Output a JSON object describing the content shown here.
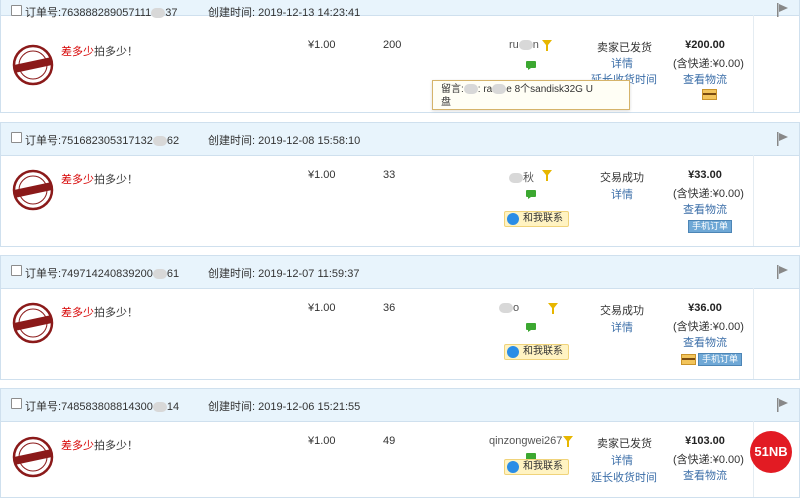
{
  "orders": [
    {
      "order_no_label": "订单号:",
      "order_no": "763888289057111",
      "order_no_tail": "37",
      "created_label": "创建时间:",
      "created": "2019-12-13 14:23:41",
      "title_highlight": "差多少",
      "title_rest": "拍多少！",
      "price": "¥1.00",
      "qty": "200",
      "buyer_left": "ru",
      "buyer_right": "n",
      "status": "卖家已发货",
      "detail": "详情",
      "extend": "延长收货时间",
      "total": "¥200.00",
      "shipping": "(含快递:¥0.00)",
      "logistics": "查看物流"
    },
    {
      "order_no_label": "订单号:",
      "order_no": "751682305317132",
      "order_no_tail": "62",
      "created_label": "创建时间:",
      "created": "2019-12-08 15:58:10",
      "title_highlight": "差多少",
      "title_rest": "拍多少！",
      "price": "¥1.00",
      "qty": "33",
      "buyer_left": "",
      "buyer_right": "秋",
      "contact": "和我联系",
      "status": "交易成功",
      "detail": "详情",
      "total": "¥33.00",
      "shipping": "(含快递:¥0.00)",
      "logistics": "查看物流",
      "mobile_order": "手机订单"
    },
    {
      "order_no_label": "订单号:",
      "order_no": "749714240839200",
      "order_no_tail": "61",
      "created_label": "创建时间:",
      "created": "2019-12-07 11:59:37",
      "title_highlight": "差多少",
      "title_rest": "拍多少！",
      "price": "¥1.00",
      "qty": "36",
      "buyer_left": "",
      "buyer_right": "o",
      "contact": "和我联系",
      "status": "交易成功",
      "detail": "详情",
      "total": "¥36.00",
      "shipping": "(含快递:¥0.00)",
      "logistics": "查看物流",
      "mobile_order": "手机订单"
    },
    {
      "order_no_label": "订单号:",
      "order_no": "748583808814300",
      "order_no_tail": "14",
      "created_label": "创建时间:",
      "created": "2019-12-06 15:21:55",
      "title_highlight": "差多少",
      "title_rest": "拍多少！",
      "price": "¥1.00",
      "qty": "49",
      "buyer": "qinzongwei267",
      "contact": "和我联系",
      "status": "卖家已发货",
      "detail": "详情",
      "extend": "延长收货时间",
      "total": "¥103.00",
      "shipping": "(含快递:¥0.00)",
      "logistics": "查看物流"
    }
  ],
  "tooltip": {
    "prefix": "留言:",
    "middle": ": ra",
    "rest": "e 8个sandisk32G U",
    "line2": "盘"
  },
  "watermark": "51NB",
  "colors": {
    "header_bg": "#e8f4fc",
    "title_highlight": "#d60000",
    "link": "#3b6ea8",
    "contact_bg": "#fff3c2",
    "watermark_bg": "#e21b23"
  }
}
